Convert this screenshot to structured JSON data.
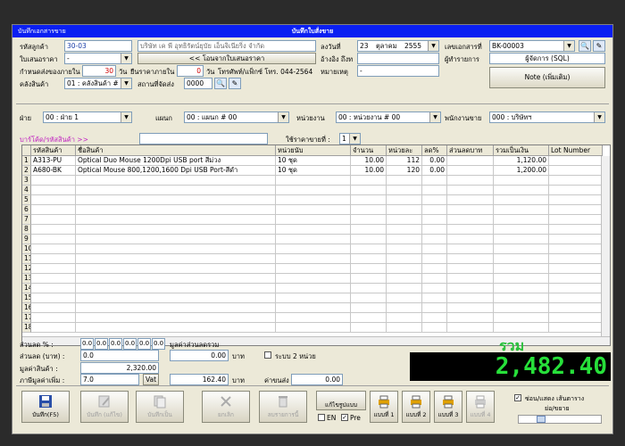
{
  "window": {
    "title_left": "บันทึกเอกสารขาย",
    "title_center": "บันทึกใบสั่งขาย"
  },
  "header": {
    "customer_code_label": "รหัสลูกค้า",
    "customer_code": "30-03",
    "customer_name": "บริษัท เค พี อุทธิรัตน์ยุบัย เอ็นจิเนียริ่ง จำกัด",
    "quotation_label": "ใบเสนอราคา",
    "quotation_value": "-",
    "import_quote_button": "<< โอนจากใบเสนอราคา",
    "delivery_within_label": "กำหนดส่งของภายใน",
    "delivery_days": "30",
    "days_unit": "วัน",
    "price_valid_label": "ยืนราคาภายใน",
    "price_valid_days": "0",
    "price_valid_unit": "วัน",
    "phone": "โทรศัพท์/แฟ็กซ์ โทร. 044-2564",
    "warehouse_label": "คลังสินค้า",
    "warehouse_value": "01 : คลังสินค้า #",
    "ship_to_label": "สถานที่จัดส่ง",
    "ship_to_value": "0000",
    "date_label": "ลงวันที่",
    "date_day": "23",
    "date_month": "ตุลาคม",
    "date_year": "2555",
    "reference_label": "อ้างอิง ถึงท",
    "reference_value": "",
    "remark_label": "หมายเหตุ",
    "remark_value": "-",
    "doc_no_label": "เลขเอกสารที่",
    "doc_no_value": "BK-00003",
    "recorder_label": "ผู้ทำรายการ",
    "recorder_value": "ผู้จัดการ (SQL)",
    "note_button": "Note (เพิ่มเติม)"
  },
  "org": {
    "division_label": "ฝ่าย",
    "division_value": "00 : ฝ่าย 1",
    "department_label": "แผนก",
    "department_value": "00 : แผนก # 00",
    "unit_label": "หน่วยงาน",
    "unit_value": "00 : หน่วยงาน # 00",
    "salesperson_label": "พนักงานขาย",
    "salesperson_value": "000 : บริษัทฯ"
  },
  "barcode": {
    "label": "บาร์โค้ด/รหัสสินค้า >>",
    "value": "",
    "price_level_label": "ใช้ราคาขายที่ :",
    "price_level_value": "1"
  },
  "grid": {
    "columns": [
      "",
      "รหัสสินค้า",
      "ชื่อสินค้า",
      "หน่วยนับ",
      "จำนวน",
      "หน่วยละ",
      "ลด%",
      "ส่วนลดบาท",
      "รวมเป็นเงิน",
      "Lot Number"
    ],
    "rows": [
      [
        "1",
        "A313-PU",
        "Optical Duo Mouse 1200Dpi USB port สีม่วง",
        "10 ชุด",
        "10.00",
        "112",
        "0.00",
        "",
        "1,120.00",
        ""
      ],
      [
        "2",
        "A680-BK",
        "Optical Mouse 800,1200,1600 Dpi USB Port-สีดำ",
        "10 ชุด",
        "10.00",
        "120",
        "0.00",
        "",
        "1,200.00",
        ""
      ],
      [
        "3",
        "",
        "",
        "",
        "",
        "",
        "",
        "",
        "",
        ""
      ],
      [
        "4",
        "",
        "",
        "",
        "",
        "",
        "",
        "",
        "",
        ""
      ],
      [
        "5",
        "",
        "",
        "",
        "",
        "",
        "",
        "",
        "",
        ""
      ],
      [
        "6",
        "",
        "",
        "",
        "",
        "",
        "",
        "",
        "",
        ""
      ],
      [
        "7",
        "",
        "",
        "",
        "",
        "",
        "",
        "",
        "",
        ""
      ],
      [
        "8",
        "",
        "",
        "",
        "",
        "",
        "",
        "",
        "",
        ""
      ],
      [
        "9",
        "",
        "",
        "",
        "",
        "",
        "",
        "",
        "",
        ""
      ],
      [
        "10",
        "",
        "",
        "",
        "",
        "",
        "",
        "",
        "",
        ""
      ],
      [
        "11",
        "",
        "",
        "",
        "",
        "",
        "",
        "",
        "",
        ""
      ],
      [
        "12",
        "",
        "",
        "",
        "",
        "",
        "",
        "",
        "",
        ""
      ],
      [
        "13",
        "",
        "",
        "",
        "",
        "",
        "",
        "",
        "",
        ""
      ],
      [
        "14",
        "",
        "",
        "",
        "",
        "",
        "",
        "",
        "",
        ""
      ],
      [
        "15",
        "",
        "",
        "",
        "",
        "",
        "",
        "",
        "",
        ""
      ],
      [
        "16",
        "",
        "",
        "",
        "",
        "",
        "",
        "",
        "",
        ""
      ],
      [
        "17",
        "",
        "",
        "",
        "",
        "",
        "",
        "",
        "",
        ""
      ],
      [
        "18",
        "",
        "",
        "",
        "",
        "",
        "",
        "",
        "",
        ""
      ]
    ]
  },
  "footer": {
    "discount_pct_label": "ส่วนลด % :",
    "discount_pct_values": [
      "0.0",
      "0.0",
      "0.0",
      "0.0",
      "0.0",
      "0.0"
    ],
    "discount_baht_label": "ส่วนลด (บาท) :",
    "discount_baht_value": "0.0",
    "total_discount_label": "มูลค่าส่วนลดรวม",
    "total_discount_value": "0.00",
    "baht_unit": "บาท",
    "two_unit_label": "ระบบ 2 หน่วย",
    "goods_value_label": "มูลค่าสินค้า :",
    "goods_value": "2,320.00",
    "vat_label": "ภาษีมูลค่าเพิ่ม :",
    "vat_rate": "7.0",
    "vat_button": "Vat",
    "vat_value": "162.40",
    "vat_unit": "บาท",
    "shipping_label": "ค่าขนส่ง",
    "shipping_value": "0.00",
    "grand_total_label": "รวม",
    "grand_total_value": "2,482.40"
  },
  "toolbar": {
    "save": "บันทึก(F5)",
    "save_edit": "บันทึก (แก้ไข)",
    "save_as": "บันทึกเป็น",
    "cancel": "ยกเลิก",
    "cancel_entry": "ลบรายการนี้",
    "print_format": "แก้ไขรูปแบบ",
    "en_label": "EN",
    "pre_label": "Pre",
    "print1": "แบบที่ 1",
    "print2": "แบบที่ 2",
    "print3": "แบบที่ 3",
    "print4": "แบบที่ 4",
    "show_grid_label": "ซ่อน/แสดง เส้นตาราง",
    "widen_label": "ย่อ/ขยาย"
  },
  "colors": {
    "titlebar": "#0a1ff2",
    "total_bg": "#000000",
    "total_fg": "#27e03a"
  }
}
